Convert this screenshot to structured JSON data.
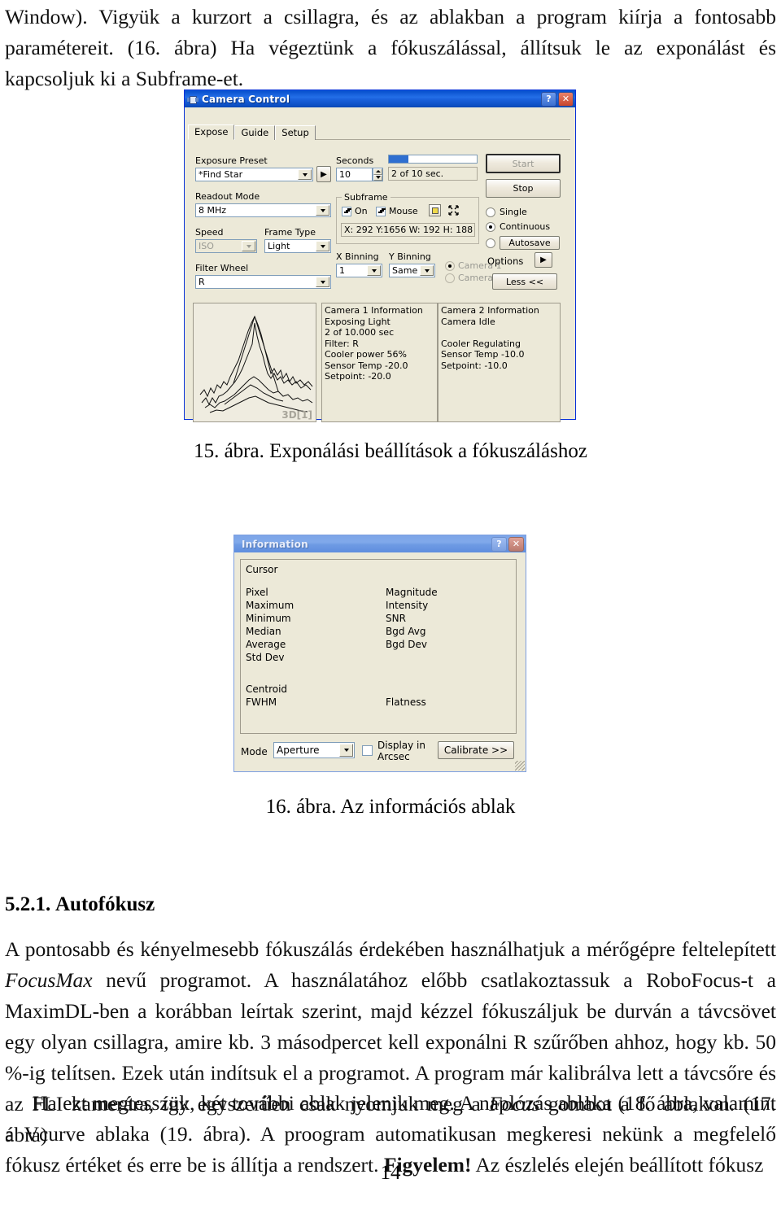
{
  "document": {
    "page_number": "14",
    "top_paragraph": "Window).  Vigyük a kurzort a csillagra, és az ablakban a program kiírja a fontosabb paramétereit. (16. ábra) Ha végeztünk a fókuszálással, állítsuk le az exponálást és kapcsoljuk ki a Subframe-et.",
    "caption_15": "15. ábra. Exponálási beállítások a fókuszáláshoz",
    "caption_16": "16. ábra. Az információs ablak",
    "section_number": "5.2.1.",
    "section_title": "Autofókusz",
    "paragraph_2_a": "A pontosabb és kényelmesebb fókuszálás érdekében használhatjuk a mérőgépre feltelepített ",
    "paragraph_2_italic1": "FocusMax",
    "paragraph_2_b": " nevű programot. A használatához előbb csatlakoztassuk a RoboFocus-t a MaximDL-ben a korábban leírtak szerint, majd kézzel fókuszáljuk be durván a távcsövet egy olyan csillagra, amire kb. 3 másodpercet kell exponálni R szűrőben ahhoz, hogy kb. 50 %-ig telítsen. Ezek után indítsuk el a programot.  A program már kalibrálva lett a távcsőre és az FLI kamerára, így egyszerűen csak nyomjuk meg a ",
    "paragraph_2_italic2": "Focus",
    "paragraph_2_c": " gombot a fő ablakon. (17. ábra)",
    "paragraph_3_a": "Ha ezt megtesszük, két további ablak jelenik meg. A naplózás ablaka (18. ábra, valamint a Vcurve ablaka (19.  ábra).  A proogram automatikusan megkeresi nekünk a megfelelő fókusz értéket és erre be is állítja a rendszert. ",
    "paragraph_3_bold": "Figyelem!",
    "paragraph_3_b": " Az észlelés elején beállított fókusz"
  },
  "camera_control": {
    "title": "Camera Control",
    "icon": "camera-icon",
    "help_button": "?",
    "close_button": "✕",
    "tabs": [
      {
        "label": "Expose",
        "active": true
      },
      {
        "label": "Guide",
        "active": false
      },
      {
        "label": "Setup",
        "active": false
      }
    ],
    "exposure_preset_label": "Exposure Preset",
    "exposure_preset_value": "*Find Star",
    "preset_go_button": "▶",
    "seconds_label": "Seconds",
    "seconds_value": "10",
    "progress_status": "2 of 10 sec.",
    "progress_percent": 20,
    "readout_mode_label": "Readout Mode",
    "readout_mode_value": "8 MHz",
    "speed_label": "Speed",
    "speed_value": "ISO",
    "frame_type_label": "Frame Type",
    "frame_type_value": "Light",
    "filter_wheel_label": "Filter Wheel",
    "filter_wheel_value": "R",
    "subframe_group_label": "Subframe",
    "subframe_on_label": "On",
    "subframe_on_checked": true,
    "subframe_mouse_label": "Mouse",
    "subframe_mouse_checked": true,
    "subframe_coords": "X: 292 Y:1656 W: 192 H: 188",
    "x_binning_label": "X Binning",
    "x_binning_value": "1",
    "y_binning_label": "Y Binning",
    "y_binning_value": "Same",
    "camera1_radio_label": "Camera 1",
    "camera2_radio_label": "Camera 2",
    "start_button": "Start",
    "stop_button": "Stop",
    "mode_single": "Single",
    "mode_continuous": "Continuous",
    "mode_autosave": "Autosave",
    "options_button": "Options",
    "options_arrow": "▶",
    "less_button": "Less <<",
    "graph_label": "3D[1]",
    "camera1_info": "Camera 1 Information\nExposing Light\n2 of 10.000 sec\nFilter: R\nCooler power 56%\nSensor Temp -20.0\nSetpoint: -20.0",
    "camera2_info": "Camera 2 Information\nCamera Idle\n\nCooler Regulating\nSensor Temp -10.0\nSetpoint: -10.0"
  },
  "information_window": {
    "title": "Information",
    "help_button": "?",
    "close_button": "✕",
    "cursor_label": "Cursor",
    "left_fields": [
      "Pixel",
      "Maximum",
      "Minimum",
      "Median",
      "Average",
      "Std Dev"
    ],
    "right_fields": [
      "Magnitude",
      "Intensity",
      "SNR",
      "",
      "Bgd Avg",
      "Bgd Dev"
    ],
    "centroid_label": "Centroid",
    "fwhm_label": "FWHM",
    "flatness_label": "Flatness",
    "mode_label": "Mode",
    "mode_value": "Aperture",
    "display_in_arcsec_label": "Display in\nArcsec",
    "display_in_arcsec_checked": false,
    "calibrate_button": "Calibrate >>"
  },
  "colors": {
    "title_active": "#0a53cf",
    "title_inactive": "#7da5e8",
    "dialog_face": "#ece9d8",
    "progress_fill": "#2f6fd0",
    "dialog_border": "#0831d9"
  }
}
